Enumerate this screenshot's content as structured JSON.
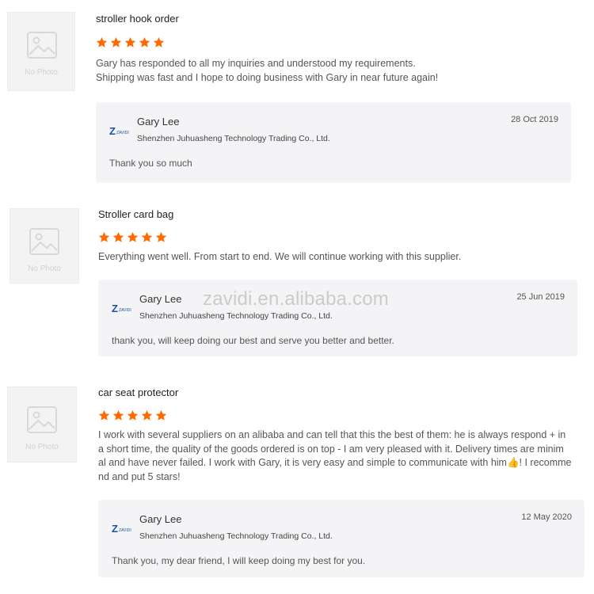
{
  "watermark": "zavidi.en.alibaba.com",
  "thumb_label": "No Photo",
  "colors": {
    "star": "#ff6a00",
    "reply_bg": "#f4f4f6"
  },
  "reviews": [
    {
      "product": "stroller hook order",
      "rating": 5,
      "text_lines": [
        "Gary has responded to all my inquiries and understood my requirements.",
        "Shipping was fast and I hope to doing business with Gary in near future again!"
      ],
      "reply": {
        "logo_text": "ZAVIDI",
        "name": "Gary Lee",
        "company": "Shenzhen Juhuasheng Technology Trading Co., Ltd.",
        "date": "28 Oct 2019",
        "message": "Thank you so much"
      }
    },
    {
      "product": "Stroller card bag",
      "rating": 5,
      "text_lines": [
        "Everything went well. From start to end. We will continue working with this supplier."
      ],
      "reply": {
        "logo_text": "ZAVIDI",
        "name": "Gary Lee",
        "company": "Shenzhen Juhuasheng Technology Trading Co., Ltd.",
        "date": "25 Jun 2019",
        "message": "thank you, will keep doing our best and serve you better and better."
      }
    },
    {
      "product": "car seat protector",
      "rating": 5,
      "text_lines": [
        "I work with several suppliers on an alibaba and can tell that this the best of them: he is always respond + in",
        "a short time, the quality of the goods ordered is on top - I am very pleased with it. Delivery times are minim",
        "al and have never failed. I work with Gary, it is very easy and simple to communicate with him👍! I recomme",
        "nd and put 5 stars!"
      ],
      "reply": {
        "logo_text": "ZAVIDI",
        "name": "Gary Lee",
        "company": "Shenzhen Juhuasheng Technology Trading Co., Ltd.",
        "date": "12 May 2020",
        "message": "Thank you, my dear friend, I will keep doing my best for you."
      }
    }
  ]
}
